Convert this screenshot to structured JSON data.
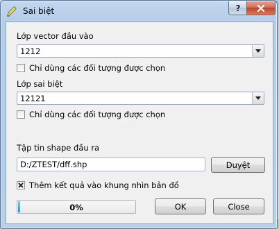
{
  "window": {
    "title": "Sai biệt",
    "icon": "qgis-pencil-icon"
  },
  "titlebar_buttons": {
    "help_label": "?",
    "close_icon": "close-icon"
  },
  "input_layer": {
    "label": "Lớp vector đầu vào",
    "selected": "1212",
    "selected_only_label": "Chỉ dùng các đối tượng được chọn",
    "selected_only_checked": false
  },
  "difference_layer": {
    "label": "Lớp sai biệt",
    "selected": "12121",
    "selected_only_label": "Chỉ dùng các đối tượng được chọn",
    "selected_only_checked": false
  },
  "output": {
    "label": "Tập tin shape đầu ra",
    "path": "D:/ZTEST/dff.shp",
    "browse_label": "Duyệt",
    "add_result_label": "Thêm kết quả vào khung nhìn bản đồ",
    "add_result_checked": true
  },
  "progress": {
    "text": "0%",
    "value": 0
  },
  "buttons": {
    "ok": "OK",
    "close": "Close"
  }
}
